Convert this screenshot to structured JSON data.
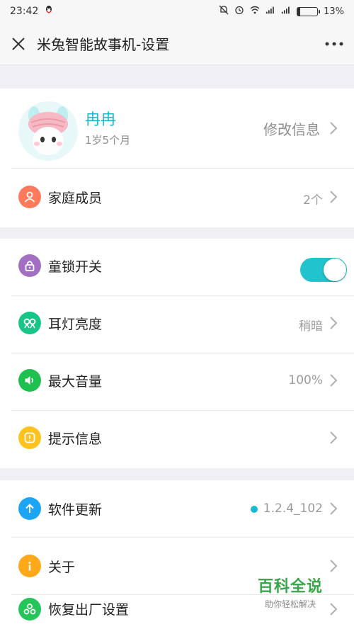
{
  "status": {
    "time": "23:42",
    "battery": "13%",
    "battery_level": 0.13
  },
  "header": {
    "title": "米兔智能故事机-设置"
  },
  "profile": {
    "name": "冉冉",
    "age": "1岁5个月",
    "edit_label": "修改信息"
  },
  "family": {
    "label": "家庭成员",
    "value": "2个",
    "icon": "person-icon",
    "color": "#ff7a5c"
  },
  "settings": [
    {
      "label": "童锁开关",
      "icon": "lock-icon",
      "color": "#a26fc3",
      "toggle": true
    },
    {
      "label": "耳灯亮度",
      "value": "稍暗",
      "icon": "ear-light-icon",
      "color": "#19c487"
    },
    {
      "label": "最大音量",
      "value": "100%",
      "icon": "speaker-icon",
      "color": "#1fc14e"
    },
    {
      "label": "提示信息",
      "value": "",
      "icon": "message-icon",
      "color": "#ffc21f"
    }
  ],
  "system": [
    {
      "label": "软件更新",
      "value": "1.2.4_102",
      "icon": "arrow-up-icon",
      "color": "#1ba5f2",
      "update_dot": true
    },
    {
      "label": "关于",
      "value": "",
      "icon": "info-icon",
      "color": "#ffa81a"
    },
    {
      "label": "恢复出厂设置",
      "value": "",
      "icon": "reset-icon",
      "color": "#25c55a"
    }
  ],
  "watermark": {
    "line1": "百科全说",
    "line2": "助你轻松解决"
  }
}
